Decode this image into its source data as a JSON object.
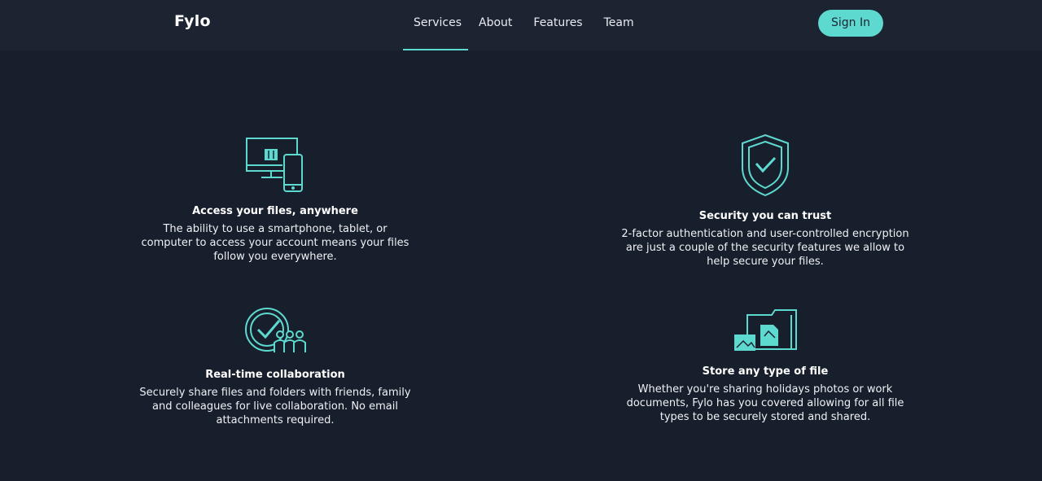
{
  "brand": {
    "logo": "Fylo"
  },
  "nav": {
    "items": [
      {
        "label": "Services"
      },
      {
        "label": "About"
      },
      {
        "label": "Features"
      },
      {
        "label": "Team"
      }
    ],
    "active": "Services",
    "signin_label": "Sign In"
  },
  "colors": {
    "accent": "#5ed9d0",
    "background": "#181f2c",
    "header": "#1c2331"
  },
  "features": [
    {
      "icon": "devices-icon",
      "title": "Access your files, anywhere",
      "text": "The ability to use a smartphone, tablet, or computer to access your account means your files follow you everywhere."
    },
    {
      "icon": "shield-check-icon",
      "title": "Security you can trust",
      "text": "2-factor authentication and user-controlled encryption are just a couple of the security features we allow to help secure your files."
    },
    {
      "icon": "collaboration-icon",
      "title": "Real-time collaboration",
      "text": "Securely share files and folders with friends, family and colleagues for live collaboration. No email attachments required."
    },
    {
      "icon": "file-types-icon",
      "title": "Store any type of file",
      "text": "Whether you're sharing holidays photos or work documents, Fylo has you covered allowing for all file types to be securely stored and shared."
    }
  ]
}
